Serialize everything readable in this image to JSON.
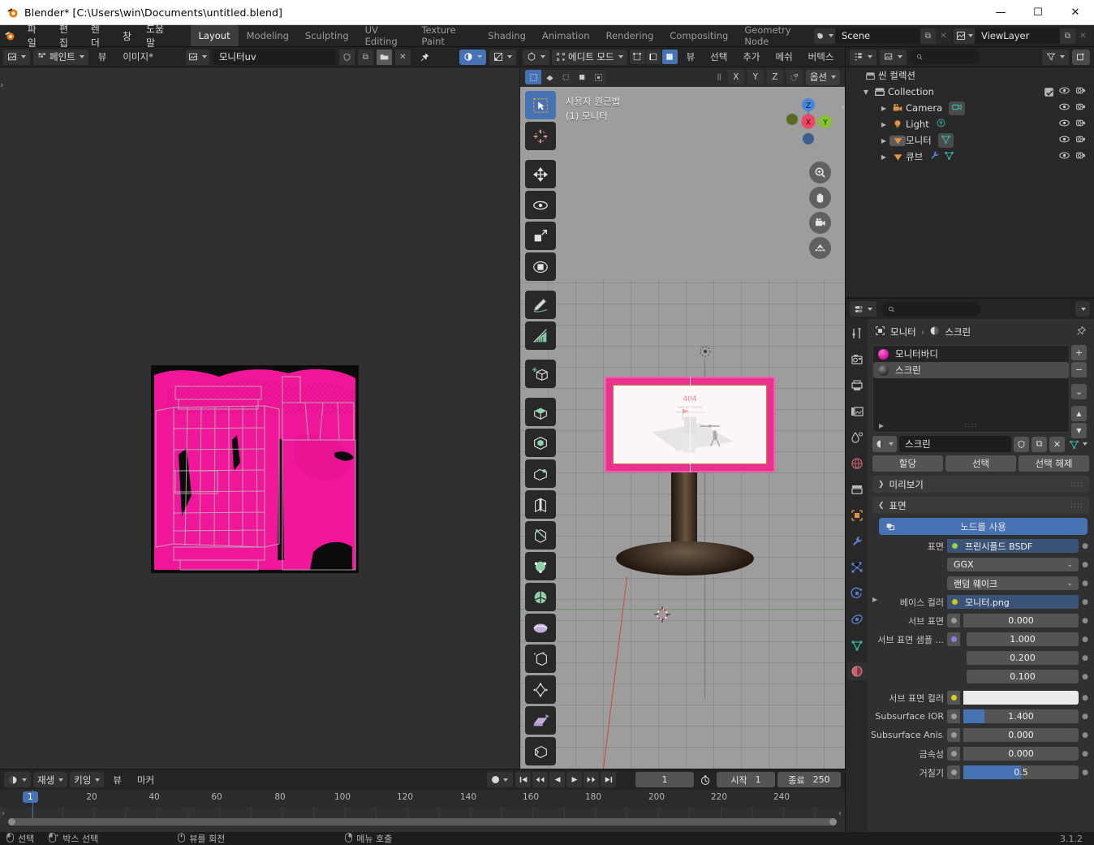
{
  "window": {
    "title": "Blender* [C:\\Users\\win\\Documents\\untitled.blend]",
    "minimize": "—",
    "maximize": "☐",
    "close": "✕"
  },
  "topbar": {
    "menus": [
      "파일",
      "편집",
      "렌더",
      "창",
      "도움말"
    ],
    "workspaces": [
      {
        "label": "Layout",
        "active": true
      },
      {
        "label": "Modeling",
        "active": false
      },
      {
        "label": "Sculpting",
        "active": false
      },
      {
        "label": "UV Editing",
        "active": false
      },
      {
        "label": "Texture Paint",
        "active": false
      },
      {
        "label": "Shading",
        "active": false
      },
      {
        "label": "Animation",
        "active": false
      },
      {
        "label": "Rendering",
        "active": false
      },
      {
        "label": "Compositing",
        "active": false
      },
      {
        "label": "Geometry Node",
        "active": false
      }
    ],
    "scene_name": "Scene",
    "viewlayer_name": "ViewLayer"
  },
  "uv_editor": {
    "editor_type_icon": "image-editor-icon",
    "mode": "페인트",
    "menus": [
      "뷰",
      "이미지*"
    ],
    "image_name": "모니터uv",
    "fake_user_icon": "shield-icon",
    "new_icon": "copy-icon",
    "open_icon": "folder-icon",
    "unlink_icon": "x-icon",
    "pin_icon": "pin-icon",
    "display_channel_icon": "color-icon",
    "overlay_icon": "overlay-icon",
    "sidebar_arrow": "›"
  },
  "viewport": {
    "editor_type_icon": "3d-viewport-icon",
    "mode": "에디트 모드",
    "menus": [
      "뷰",
      "선택",
      "추가",
      "메쉬",
      "버텍스"
    ],
    "select_modes": [
      "vertex-select",
      "edge-select",
      "face-select"
    ],
    "uv_sync_icon": "uv-sync-icon",
    "axis_buttons": [
      "X",
      "Y",
      "Z"
    ],
    "options_label": "옵션",
    "overlay_text_line1": "사용자 원근법",
    "overlay_text_line2": "(1) 모니터",
    "gizmo_axes": [
      "Z",
      "X",
      "Y"
    ],
    "nav_icons": [
      "zoom-icon",
      "hand-icon",
      "camera-icon",
      "grid-icon"
    ],
    "sidebar_arrow": "‹",
    "tools": [
      "tweak-tool",
      "cursor-tool",
      "move-tool",
      "rotate-tool",
      "scale-tool",
      "transform-tool",
      "annotate-tool",
      "measure-tool",
      "add-cube-tool",
      "extrude-region-tool",
      "inset-faces-tool",
      "bevel-tool",
      "loop-cut-tool",
      "knife-tool",
      "poly-build-tool",
      "spin-tool",
      "smooth-tool",
      "edge-slide-tool",
      "shrink-fatten-tool",
      "shear-tool",
      "rip-region-tool"
    ]
  },
  "outliner": {
    "display_mode_icon": "outliner-icon",
    "filter_icon": "filter-icon",
    "new_collection_icon": "new-collection-icon",
    "search_placeholder": "",
    "scene_collection": "씬 컬렉션",
    "items": [
      {
        "label": "Collection",
        "icon": "collection-icon",
        "indent": 1,
        "expandable": true,
        "checkbox": true,
        "eye": true,
        "camera": true
      },
      {
        "label": "Camera",
        "icon": "camera-object-icon",
        "indent": 2,
        "expandable": true,
        "data_icon": "camera-data-icon",
        "eye": true,
        "camera": true
      },
      {
        "label": "Light",
        "icon": "light-object-icon",
        "indent": 2,
        "expandable": true,
        "data_icon": "light-data-icon",
        "eye": true,
        "camera": true
      },
      {
        "label": "모니터",
        "icon": "mesh-object-icon",
        "indent": 2,
        "expandable": true,
        "data_icon": "mesh-data-icon",
        "eye": true,
        "camera": true,
        "selected": true
      },
      {
        "label": "큐브",
        "icon": "mesh-object-icon",
        "indent": 2,
        "expandable": true,
        "data_icon": "modifier-icon",
        "data_icon2": "mesh-data-icon",
        "eye": true,
        "camera": true
      }
    ]
  },
  "properties": {
    "editor_icon": "properties-icon",
    "search_placeholder": "",
    "breadcrumb": [
      "모니터",
      "스크린"
    ],
    "pin_icon": "pin-icon",
    "tabs": [
      {
        "name": "tool-tab",
        "icon": "tool-icon",
        "active": false
      },
      {
        "name": "render-tab",
        "icon": "render-icon",
        "active": false
      },
      {
        "name": "output-tab",
        "icon": "output-icon",
        "active": false
      },
      {
        "name": "viewlayer-tab",
        "icon": "viewlayer-icon",
        "active": false
      },
      {
        "name": "scene-tab",
        "icon": "scene-icon",
        "active": false
      },
      {
        "name": "world-tab",
        "icon": "world-icon",
        "active": false
      },
      {
        "name": "collection-tab",
        "icon": "collection-prop-icon",
        "active": false
      },
      {
        "name": "object-tab",
        "icon": "object-icon",
        "active": false
      },
      {
        "name": "modifier-tab",
        "icon": "wrench-icon",
        "active": false
      },
      {
        "name": "particles-tab",
        "icon": "particles-icon",
        "active": false
      },
      {
        "name": "physics-tab",
        "icon": "physics-icon",
        "active": false
      },
      {
        "name": "constraints-tab",
        "icon": "constraints-icon",
        "active": false
      },
      {
        "name": "data-tab",
        "icon": "mesh-data-icon",
        "active": false
      },
      {
        "name": "material-tab",
        "icon": "material-icon",
        "active": true
      }
    ],
    "material_slots": [
      {
        "label": "모니터바디",
        "color": "#cc119a",
        "selected": false
      },
      {
        "label": "스크린",
        "color": "#4a4a4a",
        "selected": true
      }
    ],
    "slot_buttons": [
      "+",
      "−",
      "⌄",
      "▲",
      "▼"
    ],
    "material_field": "스크린",
    "material_field_icons": [
      "shield-icon",
      "copy-icon",
      "x-icon",
      "mesh-link-icon"
    ],
    "assign_buttons": [
      "할당",
      "선택",
      "선택 해제"
    ],
    "panels": [
      {
        "label": "미리보기",
        "expanded": false
      },
      {
        "label": "표면",
        "expanded": true
      }
    ],
    "use_nodes_label": "노드를 사용",
    "surface_rows": [
      {
        "label": "표면",
        "value": "프린시플드 BSDF",
        "type": "node",
        "dot": "#9dd14b"
      },
      {
        "label": "",
        "value": "GGX",
        "type": "dropdown"
      },
      {
        "label": "",
        "value": "랜덤 웨이크",
        "type": "dropdown"
      },
      {
        "label": "베이스 컬러",
        "value": "모니터.png",
        "type": "image",
        "dot": "#ccc916",
        "expandable": true
      },
      {
        "label": "서브 표면",
        "value": "0.000",
        "type": "slider",
        "dot": "#9a9a9a",
        "fill": 0
      },
      {
        "label": "서브 표면 샘플 ...",
        "value": "1.000",
        "type": "slider",
        "dot": "#8a7fe0",
        "fill": 0
      },
      {
        "label": "",
        "value": "0.200",
        "type": "slider",
        "indent": true,
        "fill": 0
      },
      {
        "label": "",
        "value": "0.100",
        "type": "slider",
        "indent": true,
        "fill": 0
      },
      {
        "label": "서브 표면 컬러",
        "value": "",
        "type": "color",
        "dot": "#d6d117",
        "color": "#ebebeb"
      },
      {
        "label": "Subsurface IOR",
        "value": "1.400",
        "type": "slider",
        "dot": "#9a9a9a",
        "fill": 18
      },
      {
        "label": "Subsurface Anis...",
        "value": "0.000",
        "type": "slider",
        "dot": "#9a9a9a",
        "fill": 0
      },
      {
        "label": "금속성",
        "value": "0.000",
        "type": "slider",
        "dot": "#9a9a9a",
        "fill": 0
      },
      {
        "label": "거칠기",
        "value": "0.5",
        "type": "slider",
        "dot": "#9a9a9a",
        "fill": 50
      }
    ]
  },
  "timeline": {
    "editor_icon": "timeline-icon",
    "menus": [
      "재생",
      "키잉",
      "뷰",
      "마커"
    ],
    "record_icon": "record-icon",
    "transport": [
      "jump-start",
      "prev-keyframe",
      "play-reverse",
      "play",
      "next-keyframe",
      "jump-end"
    ],
    "current_frame": "1",
    "start_label": "시작",
    "start_value": "1",
    "end_label": "종료",
    "end_value": "250",
    "auto_key_icon": "stopwatch-icon",
    "ticks": [
      20,
      40,
      60,
      80,
      100,
      120,
      140,
      160,
      180,
      200,
      220,
      240
    ],
    "playhead_frame": "1"
  },
  "statusbar": {
    "items": [
      {
        "icon": "mouse-left-icon",
        "label": "선택"
      },
      {
        "icon": "mouse-left-drag-icon",
        "label": "박스 선택"
      },
      {
        "icon": "mouse-middle-icon",
        "label": "뷰를 회전"
      },
      {
        "icon": "mouse-right-icon",
        "label": "메뉴 호출"
      }
    ],
    "version": "3.1.2"
  },
  "colors": {
    "accent_blue": "#4772b3",
    "magenta": "#e8338e",
    "orange": "#e0792c",
    "bg_dark": "#1d1d1d",
    "bg_panel": "#303030",
    "bg_header": "#242424",
    "viewport_bg": "#9d9d9d"
  }
}
